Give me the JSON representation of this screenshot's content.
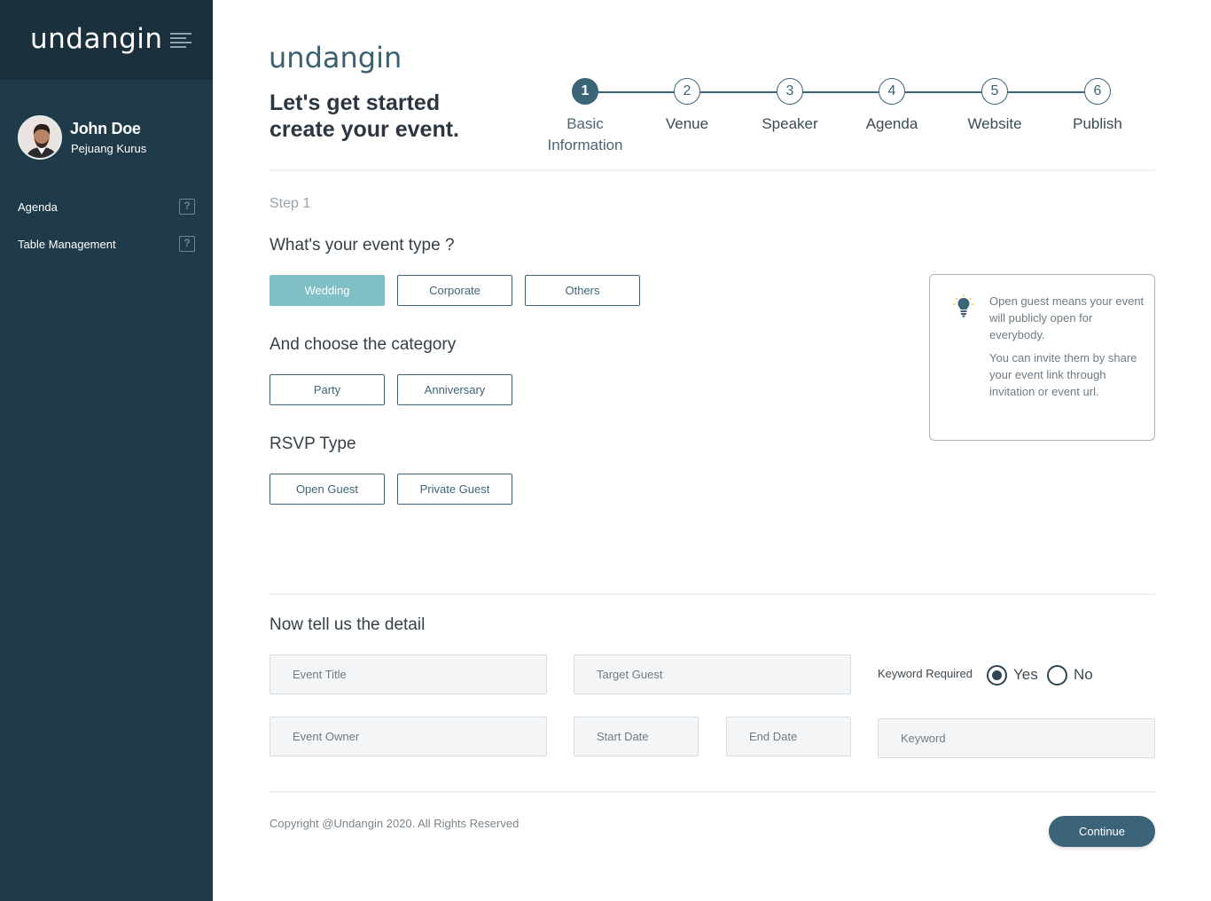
{
  "brand": {
    "logo_text": "undangin"
  },
  "sidebar": {
    "user": {
      "name": "John Doe",
      "role": "Pejuang Kurus"
    },
    "items": [
      {
        "label": "Agenda",
        "help_icon": "?"
      },
      {
        "label": "Table Management",
        "help_icon": "?"
      }
    ]
  },
  "header": {
    "headline_line1": "Let's get started",
    "headline_line2": "create your event."
  },
  "stepper": {
    "current_step": 1,
    "steps": [
      {
        "number": "1",
        "label_line1": "Basic",
        "label_line2": "Information"
      },
      {
        "number": "2",
        "label_line1": "Venue",
        "label_line2": ""
      },
      {
        "number": "3",
        "label_line1": "Speaker",
        "label_line2": ""
      },
      {
        "number": "4",
        "label_line1": "Agenda",
        "label_line2": ""
      },
      {
        "number": "5",
        "label_line1": "Website",
        "label_line2": ""
      },
      {
        "number": "6",
        "label_line1": "Publish",
        "label_line2": ""
      }
    ]
  },
  "form": {
    "step_tag": "Step 1",
    "event_type": {
      "question": "What's your event type ?",
      "options": [
        "Wedding",
        "Corporate",
        "Others"
      ],
      "selected": "Wedding"
    },
    "category": {
      "question": "And choose the category",
      "options": [
        "Party",
        "Anniversary"
      ]
    },
    "rsvp": {
      "question": "RSVP Type",
      "options": [
        "Open Guest",
        "Private Guest"
      ]
    },
    "info_card": {
      "icon": "lightbulb-icon",
      "paragraph1": "Open guest means your event will publicly open for everybody.",
      "paragraph2": "You can invite them by share your event link through invitation or event url."
    },
    "detail": {
      "heading": "Now tell us the detail",
      "event_title_placeholder": "Event Title",
      "target_guest_placeholder": "Target Guest",
      "event_owner_placeholder": "Event Owner",
      "start_date_placeholder": "Start Date",
      "end_date_placeholder": "End Date",
      "keyword_placeholder": "Keyword",
      "keyword_required_label": "Keyword Required",
      "yes_label": "Yes",
      "no_label": "No",
      "keyword_required_value": "Yes"
    }
  },
  "footer": {
    "copyright": "Copyright @Undangin 2020. All Rights Reserved",
    "continue_label": "Continue"
  },
  "colors": {
    "sidebar_bg": "#1f3a48",
    "accent": "#3b6478",
    "selected_option": "#7fbfc6"
  }
}
